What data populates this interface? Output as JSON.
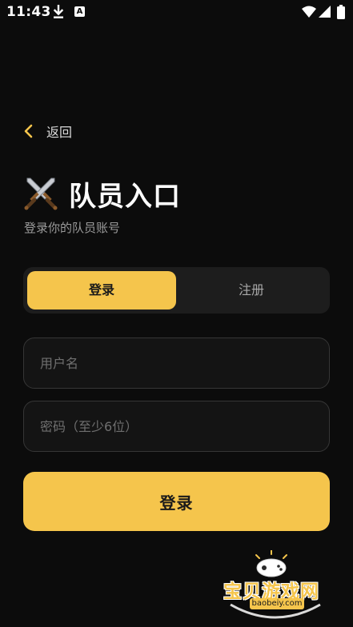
{
  "status_bar": {
    "time": "11:43",
    "badge_letter": "A"
  },
  "back": {
    "label": "返回"
  },
  "header": {
    "title": "队员入口",
    "subtitle": "登录你的队员账号"
  },
  "tabs": [
    {
      "label": "登录",
      "selected": true
    },
    {
      "label": "注册",
      "selected": false
    }
  ],
  "form": {
    "username_placeholder": "用户名",
    "username_value": "",
    "password_placeholder": "密码（至少6位）",
    "password_value": "",
    "submit_label": "登录"
  },
  "watermark": {
    "title": "宝贝游戏网",
    "domain": "baobeiy.com"
  },
  "colors": {
    "accent": "#f5c54c",
    "background": "#0c0c0c",
    "surface": "#1d1d1d",
    "field_border": "#363636"
  }
}
